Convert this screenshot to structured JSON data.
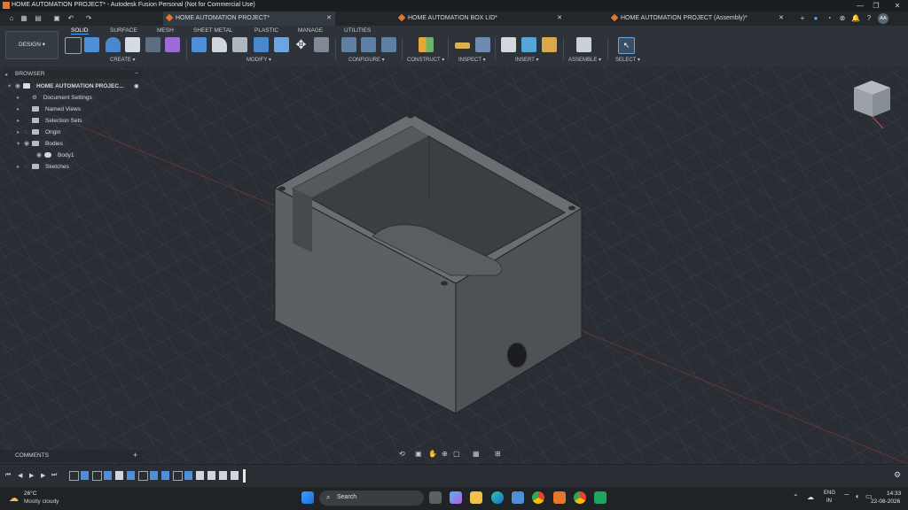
{
  "window": {
    "title": "HOME AUTOMATION PROJECT* - Autodesk Fusion Personal (Not for Commercial Use)",
    "controls": [
      "—",
      "❐",
      "✕"
    ]
  },
  "tabs": [
    {
      "label": "HOME AUTOMATION PROJECT*",
      "active": true
    },
    {
      "label": "HOME AUTOMATION BOX LID*",
      "active": false
    },
    {
      "label": "HOME AUTOMATION PROJECT (Assembly)*",
      "active": false
    }
  ],
  "tab_close": "✕",
  "tab_add": "+",
  "user_initials": "AA",
  "workspace": {
    "label": "DESIGN ▾"
  },
  "workspace_tabs": [
    "SOLID",
    "SURFACE",
    "MESH",
    "SHEET METAL",
    "PLASTIC",
    "MANAGE",
    "UTILITIES"
  ],
  "tool_groups": [
    "CREATE ▾",
    "MODIFY ▾",
    "CONFIGURE ▾",
    "CONSTRUCT ▾",
    "INSPECT ▾",
    "INSERT ▾",
    "ASSEMBLE ▾",
    "SELECT ▾"
  ],
  "browser": {
    "title": "BROWSER",
    "root": "HOME AUTOMATION PROJEC...",
    "items": [
      {
        "label": "Document Settings"
      },
      {
        "label": "Named Views"
      },
      {
        "label": "Selection Sets"
      },
      {
        "label": "Origin"
      },
      {
        "label": "Bodies"
      },
      {
        "label": "Body1"
      },
      {
        "label": "Sketches"
      }
    ]
  },
  "comments": {
    "label": "COMMENTS",
    "add": "+"
  },
  "taskbar": {
    "weather_temp": "26°C",
    "weather_desc": "Mostly cloudy",
    "search_placeholder": "Search",
    "lang_1": "ENG",
    "lang_2": "IN",
    "time": "14:33",
    "date": "22-08-2026"
  },
  "colors": {
    "accent": "#4aa3ff",
    "fusion_orange": "#e8752a",
    "model_gray": "#5a5d61"
  }
}
